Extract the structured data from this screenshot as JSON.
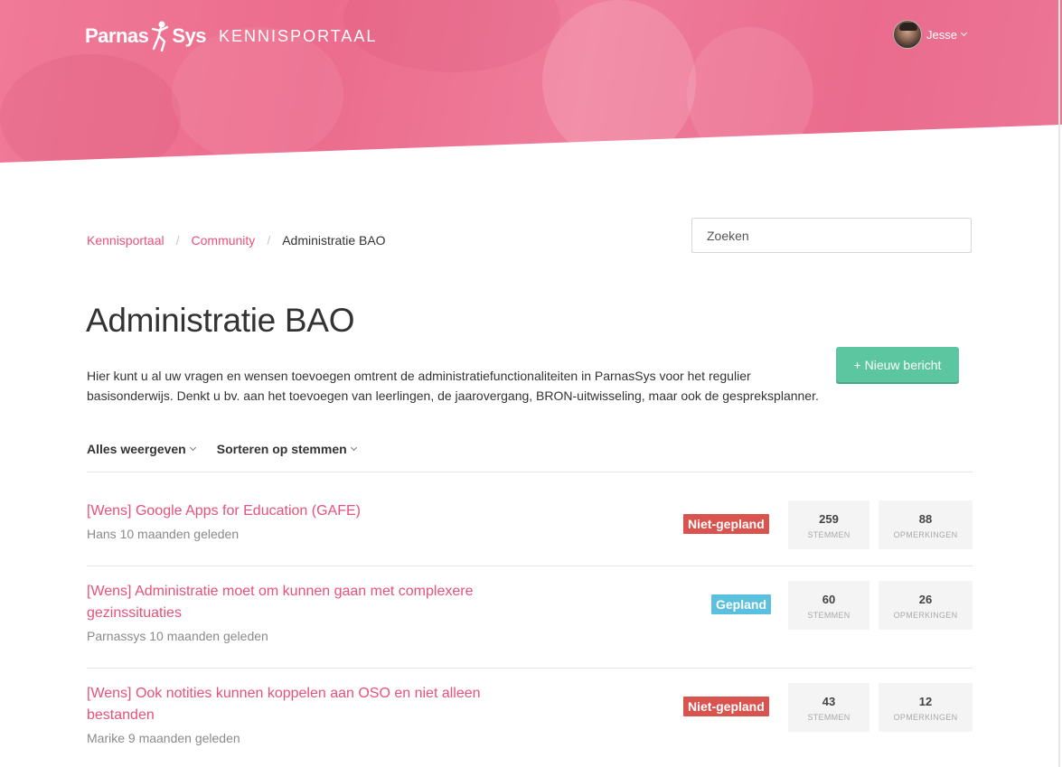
{
  "header": {
    "brand_left": "Parnas",
    "brand_right": "Sys",
    "portal": "KENNISPORTAAL",
    "user_name": "Jesse"
  },
  "breadcrumb": {
    "items": [
      "Kennisportaal",
      "Community"
    ],
    "separator": "/",
    "current": "Administratie BAO"
  },
  "search": {
    "placeholder": "Zoeken"
  },
  "page": {
    "title": "Administratie BAO",
    "description": "Hier kunt u al uw vragen en wensen toevoegen omtrent de administratiefunctionaliteiten in ParnasSys voor het regulier basisonderwijs. Denkt u bv. aan het toevoegen van leerlingen, de jaarovergang, BRON-uitwisseling, maar ook de gespreksplanner.",
    "new_button": "+ Nieuw bericht"
  },
  "filters": [
    "Alles weergeven",
    "Sorteren op stemmen"
  ],
  "posts": [
    {
      "title": "[Wens] Google Apps for Education (GAFE)",
      "author": "Hans",
      "time": "10 maanden geleden",
      "meta": "Hans 10 maanden geleden",
      "status": "Niet-gepland",
      "status_color": "#d9534f",
      "votes": "259",
      "votes_label": "STEMMEN",
      "comments": "88",
      "comments_label": "OPMERKINGEN"
    },
    {
      "title": "[Wens] Administratie moet om kunnen gaan met complexere gezinssituaties",
      "author": "Parnassys",
      "time": "10 maanden geleden",
      "meta": "Parnassys 10 maanden geleden",
      "status": "Gepland",
      "status_color": "#5bc0de",
      "votes": "60",
      "votes_label": "STEMMEN",
      "comments": "26",
      "comments_label": "OPMERKINGEN"
    },
    {
      "title": "[Wens] Ook notities kunnen koppelen aan OSO en niet alleen bestanden",
      "author": "Marike",
      "time": "9 maanden geleden",
      "meta": "Marike 9 maanden geleden",
      "status": "Niet-gepland",
      "status_color": "#d9534f",
      "votes": "43",
      "votes_label": "STEMMEN",
      "comments": "12",
      "comments_label": "OPMERKINGEN"
    }
  ],
  "colors": {
    "accent": "#e8517a",
    "hero": "#ec6c8d",
    "button": "#5cc6a0"
  },
  "icons": [
    "user-avatar",
    "chevron-down-icon",
    "logo-figure-icon"
  ]
}
